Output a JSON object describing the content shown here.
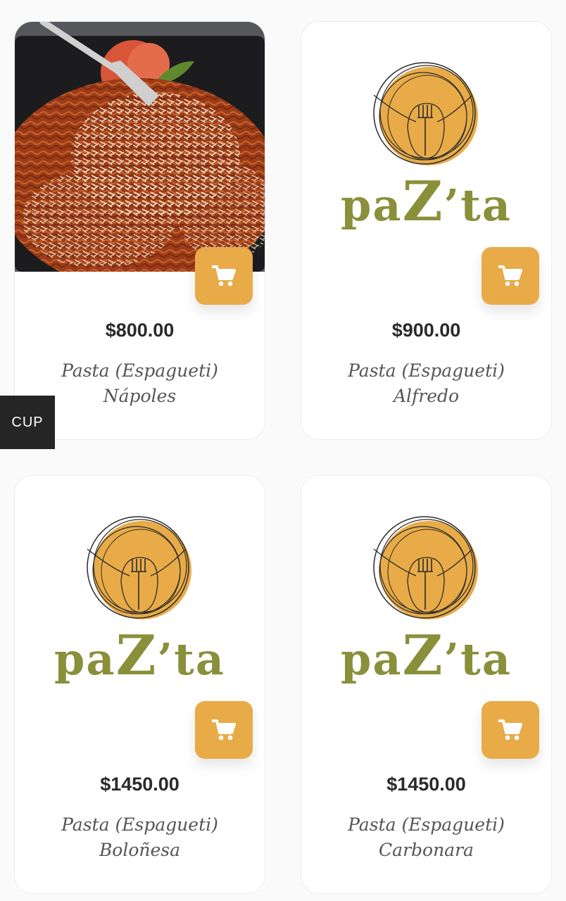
{
  "currency_tab": {
    "label": "CUP"
  },
  "brand": {
    "pre": "pa",
    "big": "Z",
    "post": "’ta"
  },
  "colors": {
    "accent": "#e8ab48",
    "brand_green": "#8a8f3a",
    "price_text": "#2a2a2a",
    "name_text": "#555555"
  },
  "products": [
    {
      "price": "$800.00",
      "name_line1": "Pasta (Espagueti)",
      "name_line2": "Nápoles",
      "media": "photo",
      "cart_icon": "cart-icon"
    },
    {
      "price": "$900.00",
      "name_line1": "Pasta (Espagueti)",
      "name_line2": "Alfredo",
      "media": "logo",
      "cart_icon": "cart-icon"
    },
    {
      "price": "$1450.00",
      "name_line1": "Pasta (Espagueti)",
      "name_line2": "Boloñesa",
      "media": "logo",
      "cart_icon": "cart-icon"
    },
    {
      "price": "$1450.00",
      "name_line1": "Pasta (Espagueti)",
      "name_line2": "Carbonara",
      "media": "logo",
      "cart_icon": "cart-icon"
    }
  ]
}
